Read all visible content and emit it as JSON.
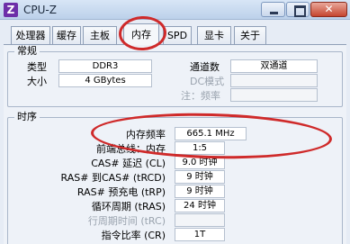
{
  "window": {
    "app_icon_glyph": "Z",
    "title": "CPU-Z",
    "close_glyph": "✕",
    "titlebar_color": "#c9dbef",
    "close_color": "#c5452f"
  },
  "tabs": [
    {
      "label": "处理器",
      "active": false
    },
    {
      "label": "缓存",
      "active": false
    },
    {
      "label": "主板",
      "active": false
    },
    {
      "label": "内存",
      "active": true
    },
    {
      "label": "SPD",
      "active": false
    },
    {
      "label": "显卡",
      "active": false
    },
    {
      "label": "关于",
      "active": false
    }
  ],
  "general": {
    "title": "常规",
    "type_label": "类型",
    "type_value": "DDR3",
    "size_label": "大小",
    "size_value": "4 GBytes",
    "channels_label": "通道数",
    "channels_value": "双通道",
    "dc_mode_label": "DC模式",
    "dc_mode_value": "",
    "note_label": "注：频率",
    "note_value": ""
  },
  "timings": {
    "title": "时序",
    "rows": [
      {
        "label": "内存频率",
        "value": "665.1 MHz",
        "disabled": false
      },
      {
        "label": "前端总线：内存",
        "value": "1:5",
        "disabled": false
      },
      {
        "label": "CAS# 延迟 (CL)",
        "value": "9.0 时钟",
        "disabled": false
      },
      {
        "label": "RAS# 到CAS# (tRCD)",
        "value": "9 时钟",
        "disabled": false
      },
      {
        "label": "RAS# 预充电 (tRP)",
        "value": "9 时钟",
        "disabled": false
      },
      {
        "label": "循环周期 (tRAS)",
        "value": "24 时钟",
        "disabled": false
      },
      {
        "label": "行周期时间 (tRC)",
        "value": "",
        "disabled": true
      },
      {
        "label": "指令比率 (CR)",
        "value": "1T",
        "disabled": false
      }
    ]
  },
  "annotations": {
    "marker_color": "#cf2a2a"
  }
}
